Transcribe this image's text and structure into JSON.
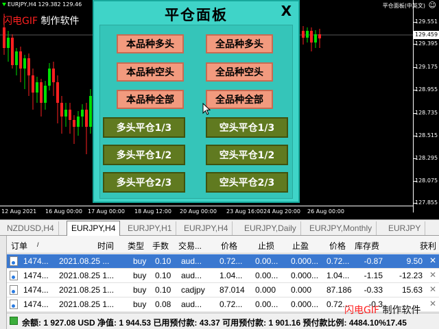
{
  "chart": {
    "title": "EURJPY,H4  129.382 129.46",
    "watermark": {
      "part1": "闪电",
      "part2": "GIF",
      "part3": " 制作软件"
    },
    "ea_label": "平仓面板(中英文)",
    "price_labels": [
      "129.551",
      "129.459",
      "129.395",
      "129.175",
      "128.955",
      "128.735",
      "128.515",
      "128.295",
      "128.075",
      "127.855"
    ],
    "current_price": "129.459",
    "time_labels": [
      "12 Aug 2021",
      "16 Aug 00:00",
      "17 Aug 00:00",
      "18 Aug 12:00",
      "20 Aug 00:00",
      "23 Aug 16:00",
      "24 Aug 20:00",
      "26 Aug 00:00"
    ],
    "colors": {
      "bull": "#00e000",
      "bear": "#ff2020",
      "background": "#000000"
    }
  },
  "panel": {
    "title": "平仓面板",
    "close_label": "X",
    "buttons": {
      "sym_buy": "本品种多头",
      "all_buy": "全品种多头",
      "sym_sell": "本品种空头",
      "all_sell": "全品种空头",
      "sym_all": "本品种全部",
      "all_all": "全品种全部",
      "buy_third": "多头平仓1/3",
      "sell_third": "空头平仓1/3",
      "buy_half": "多头平仓1/2",
      "sell_half": "空头平仓1/2",
      "buy_twothirds": "多头平仓2/3",
      "sell_twothirds": "空头平仓2/3"
    }
  },
  "tabs": [
    "NZDUSD,H4",
    "EURJPY,H4",
    "EURJPY,H1",
    "EURJPY,H4",
    "EURJPY,Daily",
    "EURJPY,Monthly",
    "EURJPY"
  ],
  "active_tab": 1,
  "table": {
    "headers": [
      "订单",
      "/",
      "时间",
      "类型",
      "手数",
      "交易...",
      "价格",
      "止损",
      "止盈",
      "价格",
      "库存费",
      "获利"
    ],
    "rows": [
      {
        "order": "1474...",
        "time": "2021.08.25 ...",
        "type": "buy",
        "lots": "0.10",
        "symbol": "aud...",
        "price": "0.72...",
        "sl": "0.00...",
        "tp": "0.000...",
        "cur": "0.72...",
        "swap": "-0.87",
        "profit": "9.50"
      },
      {
        "order": "1474...",
        "time": "2021.08.25 1...",
        "type": "buy",
        "lots": "0.10",
        "symbol": "aud...",
        "price": "1.04...",
        "sl": "0.00...",
        "tp": "0.000...",
        "cur": "1.04...",
        "swap": "-1.15",
        "profit": "-12.23"
      },
      {
        "order": "1474...",
        "time": "2021.08.25 1...",
        "type": "buy",
        "lots": "0.10",
        "symbol": "cadjpy",
        "price": "87.014",
        "sl": "0.000",
        "tp": "0.000",
        "cur": "87.186",
        "swap": "-0.33",
        "profit": "15.63"
      },
      {
        "order": "1474...",
        "time": "2021.08.25 1...",
        "type": "buy",
        "lots": "0.08",
        "symbol": "aud...",
        "price": "0.72...",
        "sl": "0.00...",
        "tp": "0.000...",
        "cur": "0.72...",
        "swap": "-0.3",
        "profit": ""
      }
    ],
    "footer": "余额: 1 927.08 USD  净值: 1 944.53  已用预付款: 43.37  可用预付款: 1 901.16  预付款比例: 4484.10%",
    "footer_tail": "17.45"
  }
}
